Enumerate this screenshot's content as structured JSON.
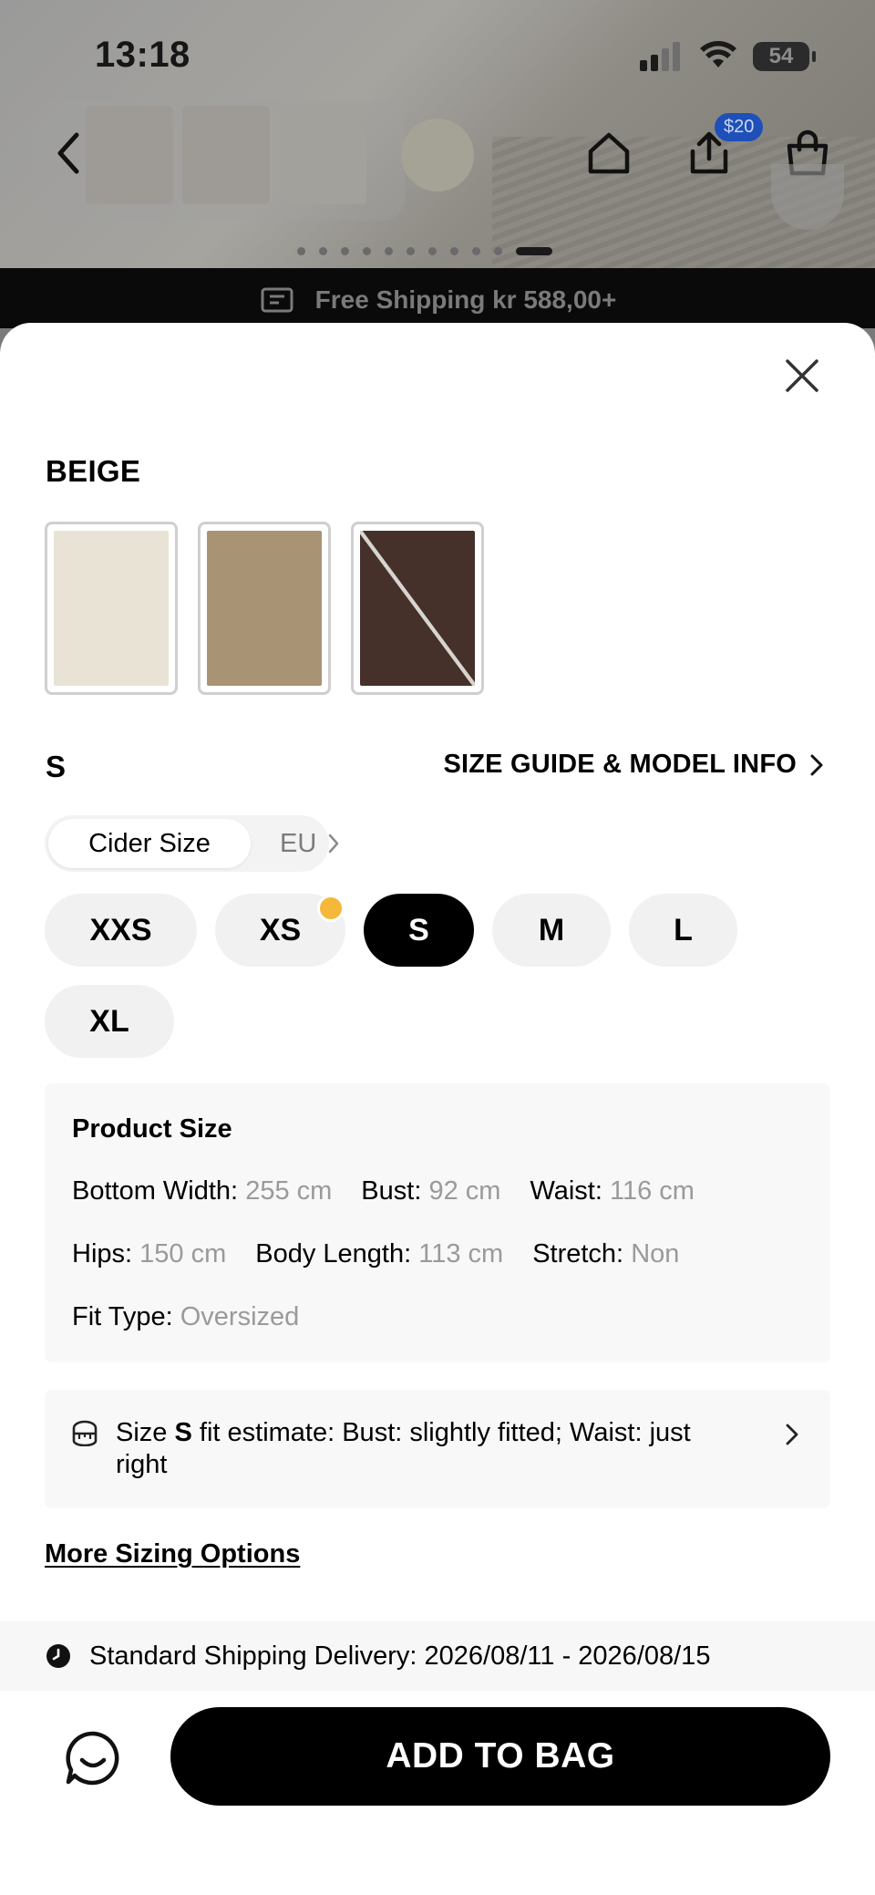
{
  "status_bar": {
    "time": "13:18",
    "battery": "54"
  },
  "background": {
    "coupon_badge": "$20",
    "shipping_banner": "Free Shipping kr 588,00+"
  },
  "color": {
    "selected_name": "BEIGE",
    "swatches": [
      {
        "name": "beige",
        "hex": "#e8e3d4",
        "available": true
      },
      {
        "name": "tan",
        "hex": "#a99375",
        "available": true
      },
      {
        "name": "brown",
        "hex": "#45312a",
        "available": false
      }
    ]
  },
  "size": {
    "selected": "S",
    "guide_link": "SIZE GUIDE & MODEL INFO",
    "systems": {
      "active": "Cider Size",
      "other": "EU"
    },
    "options": [
      "XXS",
      "XS",
      "S",
      "M",
      "L",
      "XL"
    ]
  },
  "product_size": {
    "title": "Product Size",
    "rows": [
      [
        {
          "label": "Bottom Width:",
          "value": "255 cm"
        },
        {
          "label": "Bust:",
          "value": "92 cm"
        },
        {
          "label": "Waist:",
          "value": "116 cm"
        }
      ],
      [
        {
          "label": "Hips:",
          "value": "150 cm"
        },
        {
          "label": "Body Length:",
          "value": "113 cm"
        },
        {
          "label": "Stretch:",
          "value": "Non"
        }
      ],
      [
        {
          "label": "Fit Type:",
          "value": "Oversized"
        }
      ]
    ]
  },
  "fit_estimate": {
    "prefix": "Size",
    "size": "S",
    "text": "fit estimate: Bust: slightly fitted; Waist: just right"
  },
  "more_sizing": "More Sizing Options",
  "delivery": "Standard Shipping Delivery: 2026/08/11 - 2026/08/15",
  "cta": "ADD TO BAG",
  "colors": {
    "accent": "#000000",
    "badge": "#1f4fb8",
    "dot": "#f5b83a"
  }
}
